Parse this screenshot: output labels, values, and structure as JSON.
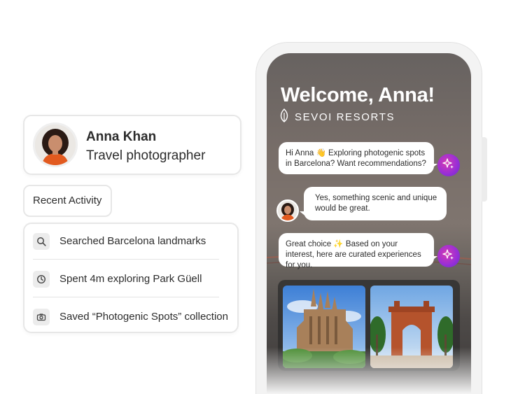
{
  "profile": {
    "name": "Anna Khan",
    "role": "Travel photographer"
  },
  "recent_activity": {
    "label": "Recent Activity",
    "items": [
      {
        "icon": "search-icon",
        "text": "Searched Barcelona landmarks"
      },
      {
        "icon": "clock-icon",
        "text": "Spent 4m exploring Park Güell"
      },
      {
        "icon": "camera-icon",
        "text": "Saved “Photogenic Spots” collection"
      }
    ]
  },
  "app": {
    "welcome": "Welcome, Anna!",
    "brand": "SEVOI RESORTS",
    "messages": [
      {
        "from": "assistant",
        "text": "Hi Anna 👋 Exploring photogenic spots in Barcelona? Want recommendations?"
      },
      {
        "from": "user",
        "text": "Yes, something scenic and unique would be great."
      },
      {
        "from": "assistant",
        "text": "Great choice ✨ Based on your interest, here are curated experiences for you."
      }
    ]
  },
  "colors": {
    "card_border": "#e7e7e7",
    "text": "#2c2c2c",
    "ai_badge_start": "#d63bb0",
    "ai_badge_end": "#6a2ad1"
  }
}
